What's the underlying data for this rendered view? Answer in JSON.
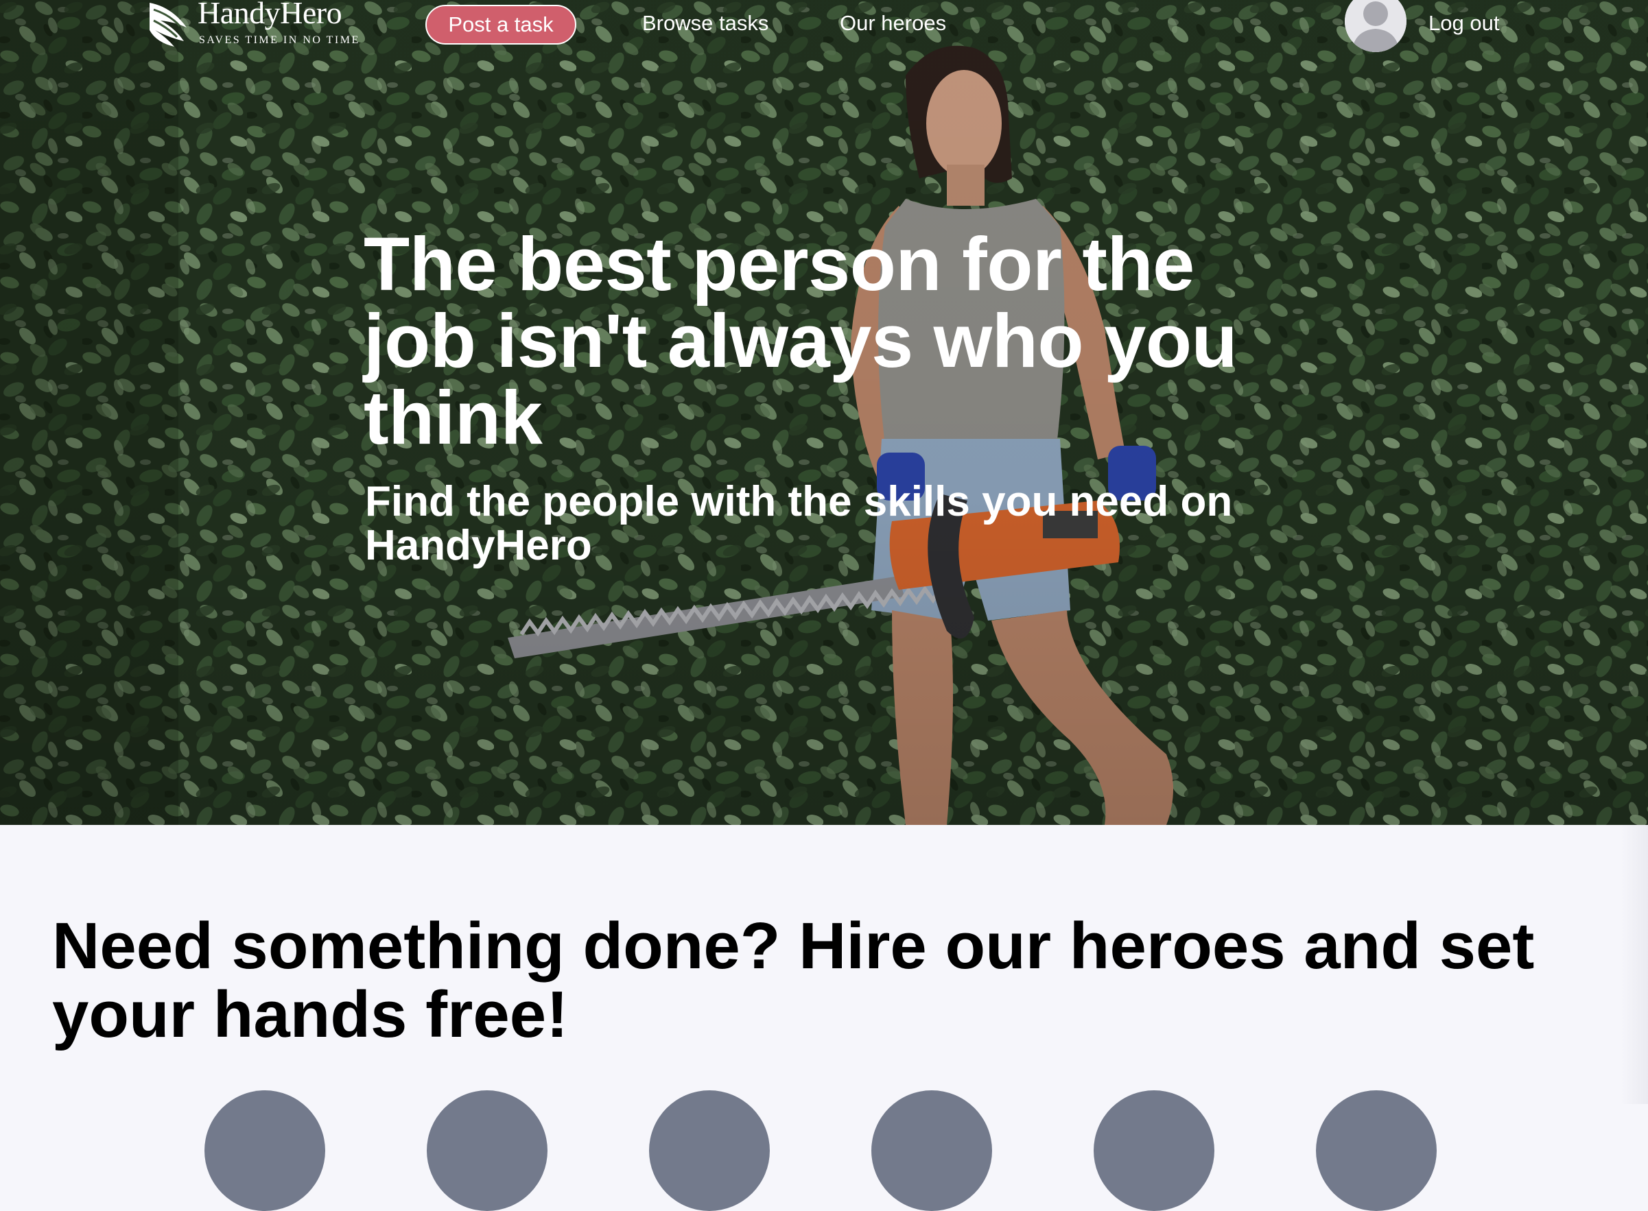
{
  "brand": {
    "name": "HandyHero",
    "tagline": "SAVES  TIME  IN  NO  TIME"
  },
  "nav": {
    "post_task": "Post a task",
    "browse_tasks": "Browse tasks",
    "our_heroes": "Our heroes",
    "log_out": "Log out"
  },
  "hero": {
    "title": "The best person for the job isn't always who you think",
    "subtitle": "Find the people with the skills you need on HandyHero",
    "image_description_icon": "hero-photo"
  },
  "main": {
    "heading": "Need something done? Hire our heroes and set your hands free!",
    "category_icons": [
      "category-icon-1",
      "category-icon-2",
      "category-icon-3",
      "category-icon-4",
      "category-icon-5",
      "category-icon-6"
    ]
  },
  "colors": {
    "accent": "#d05f6c",
    "page_bg": "#f6f6fb",
    "circle": "#737a8c"
  }
}
